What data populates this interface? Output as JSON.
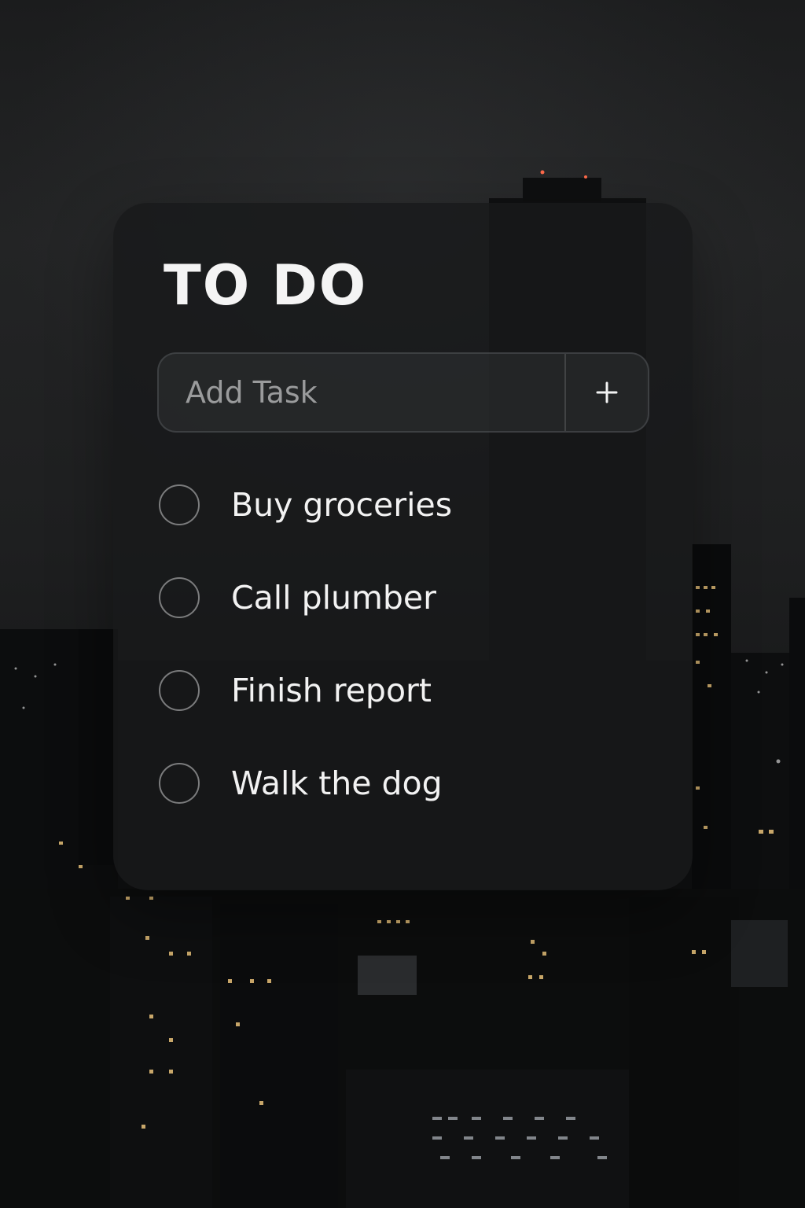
{
  "card": {
    "title": "TO DO"
  },
  "add_task": {
    "placeholder": "Add Task",
    "button_icon": "plus-icon"
  },
  "tasks": [
    {
      "label": "Buy groceries",
      "done": false
    },
    {
      "label": "Call plumber",
      "done": false
    },
    {
      "label": "Finish report",
      "done": false
    },
    {
      "label": "Walk the dog",
      "done": false
    }
  ],
  "colors": {
    "background": "#151617",
    "card": "#18191a",
    "text": "#f2f2f2",
    "placeholder": "#9a9b9c",
    "checkbox_border": "#7b7c7d",
    "window_light": "#e9c27a"
  }
}
